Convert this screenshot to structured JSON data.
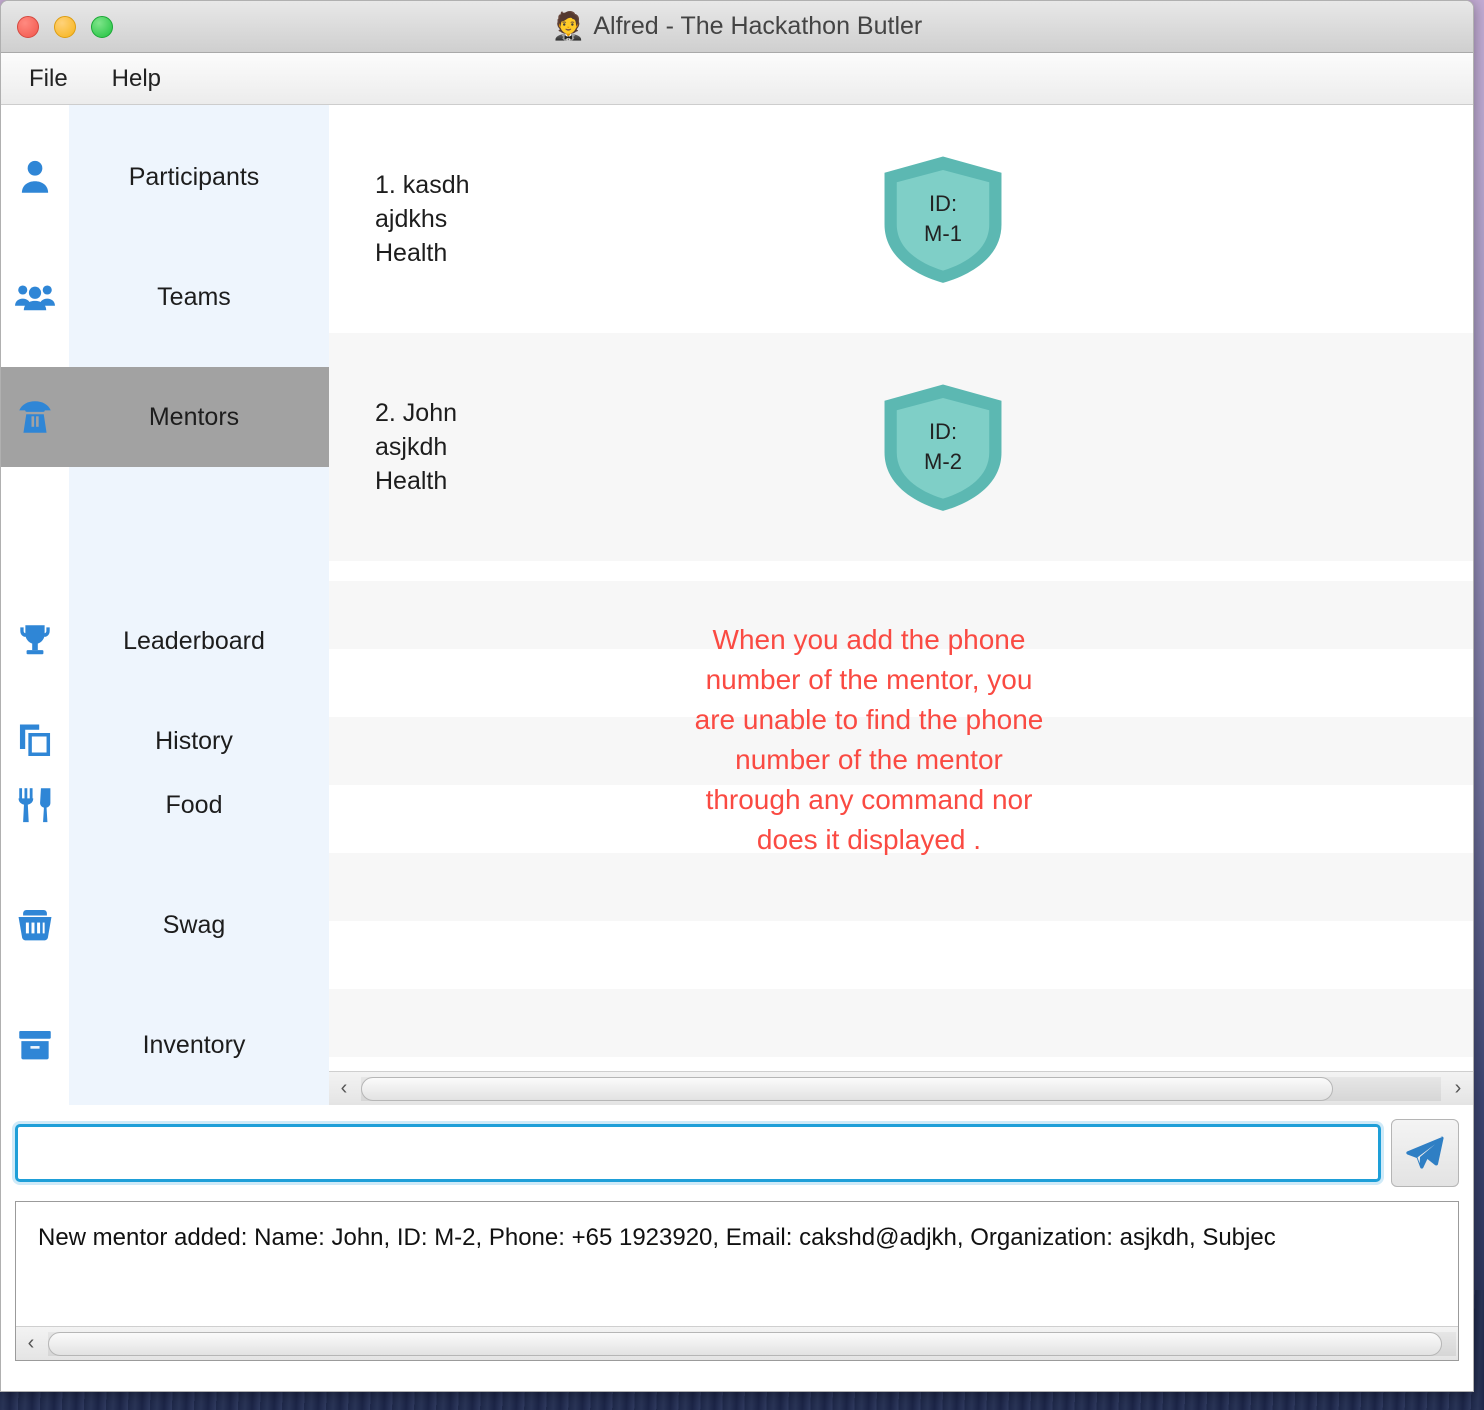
{
  "window": {
    "title": "Alfred - The Hackathon Butler",
    "title_icon": "butler-emoji",
    "traffic_lights": [
      "close",
      "minimize",
      "zoom"
    ]
  },
  "menubar": {
    "items": [
      {
        "label": "File"
      },
      {
        "label": "Help"
      }
    ]
  },
  "sidebar": {
    "items": [
      {
        "label": "Participants",
        "icon": "person-icon",
        "active": false
      },
      {
        "label": "Teams",
        "icon": "people-group-icon",
        "active": false
      },
      {
        "label": "Mentors",
        "icon": "detective-icon",
        "active": true
      },
      {
        "label": "Leaderboard",
        "icon": "trophy-icon",
        "active": false
      },
      {
        "label": "History",
        "icon": "copy-icon",
        "active": false
      },
      {
        "label": "Food",
        "icon": "cutlery-icon",
        "active": false
      },
      {
        "label": "Swag",
        "icon": "basket-icon",
        "active": false
      },
      {
        "label": "Inventory",
        "icon": "box-icon",
        "active": false
      }
    ]
  },
  "main": {
    "mentors": [
      {
        "index": "1.",
        "name": "kasdh",
        "organization": "ajdkhs",
        "subject": "Health",
        "text": "1.  kasdh\najdkhs\nHealth",
        "badge_title": "ID:",
        "badge_value": "M-1"
      },
      {
        "index": "2.",
        "name": "John",
        "organization": "asjkdh",
        "subject": "Health",
        "text": "2.  John\nasjkdh\nHealth",
        "badge_title": "ID:",
        "badge_value": "M-2"
      }
    ],
    "annotation": "When you add the phone\nnumber of the mentor, you\nare unable to find the phone\nnumber of the mentor\nthrough any command nor\ndoes it displayed .",
    "annotation_color": "#fa4a42",
    "scrollbar": {
      "left_arrow": "‹",
      "right_arrow": "›"
    }
  },
  "composer": {
    "input_value": "",
    "input_placeholder": "",
    "send_icon": "paper-plane-icon"
  },
  "status": {
    "text": "New mentor added:  Name: John, ID: M-2, Phone: +65 1923920, Email: cakshd@adjkh, Organization: asjkdh, Subjec",
    "scrollbar": {
      "left_arrow": "‹"
    }
  },
  "colors": {
    "accent_blue": "#2f86d6",
    "sidebar_label_bg": "#eef5fd",
    "active_item_bg": "#a2a2a2",
    "shield_outer": "#5cb8b2",
    "shield_inner": "#7fcfc7",
    "input_focus_border": "#1e9fd8",
    "annotation_red": "#fa4a42"
  }
}
